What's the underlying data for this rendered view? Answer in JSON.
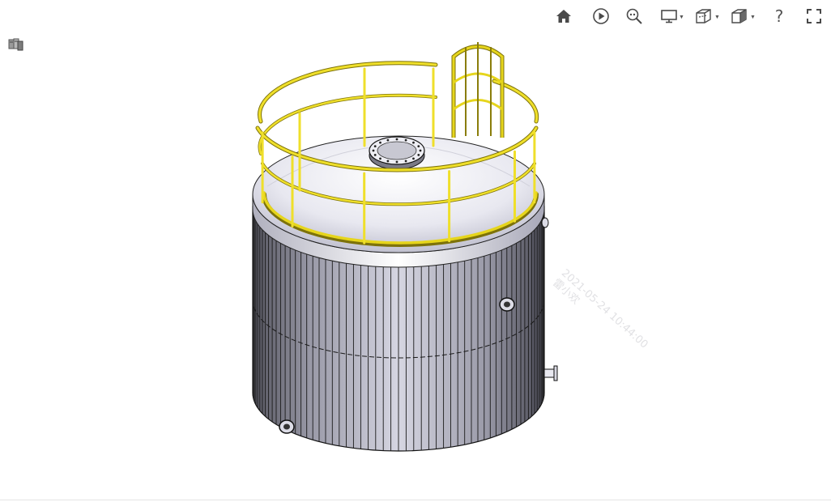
{
  "toolbar": {
    "buttons": [
      {
        "name": "home-icon",
        "label": "Home"
      },
      {
        "name": "play-icon",
        "label": "Play"
      },
      {
        "name": "zoom-icon",
        "label": "Zoom"
      },
      {
        "name": "display-icon",
        "label": "Display"
      },
      {
        "name": "section-view-icon",
        "label": "Section"
      },
      {
        "name": "view-orientation-icon",
        "label": "View"
      },
      {
        "name": "help-icon",
        "label": "?"
      },
      {
        "name": "fullscreen-icon",
        "label": "Fullscreen"
      }
    ],
    "help_label": "?"
  },
  "model": {
    "colors": {
      "railing": "#e2d21c",
      "railing_dark": "#8a7d0a",
      "shell": "#c8c8d4",
      "shell_dark": "#5a5a66",
      "dome": "#ececf2",
      "outline": "#111111"
    }
  },
  "watermark": {
    "line1": "2021-05-24 10:44:00",
    "line2": "雷小欢"
  }
}
